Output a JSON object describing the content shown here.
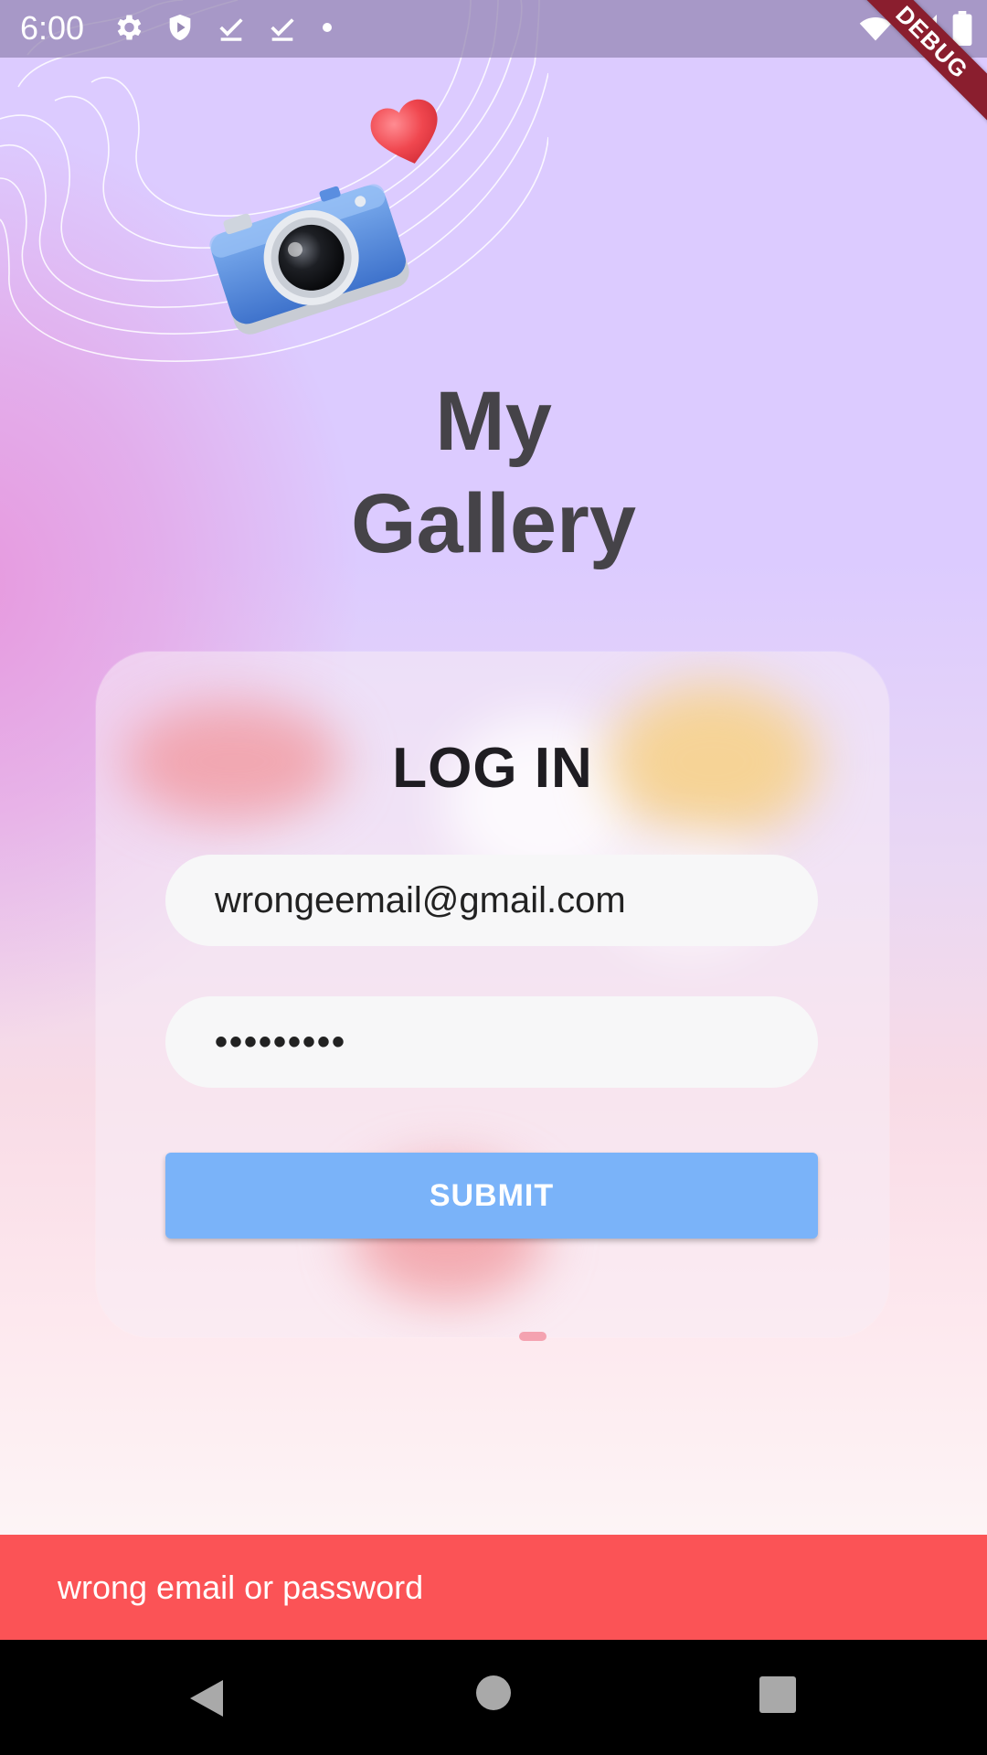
{
  "status_bar": {
    "time": "6:00",
    "left_icons": [
      "settings-icon",
      "shield-icon",
      "download-done-icon",
      "download-done-icon",
      "dot-icon"
    ],
    "right_icons": [
      "wifi-icon",
      "signal-icon",
      "battery-icon"
    ]
  },
  "debug_banner": "DEBUG",
  "app": {
    "title_line1": "My",
    "title_line2": "Gallery"
  },
  "login": {
    "title": "LOG IN",
    "email_value": "wrongeemail@gmail.com",
    "password_value": "•••••••••",
    "submit_label": "SUBMIT"
  },
  "snackbar": {
    "message": "wrong email or password"
  },
  "colors": {
    "accent": "#7ab3f9",
    "error": "#fb5356",
    "title": "#454348"
  }
}
